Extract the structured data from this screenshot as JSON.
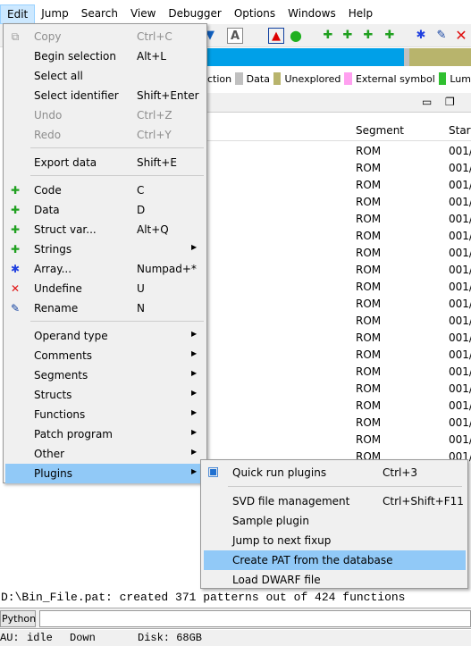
{
  "menubar": [
    "Edit",
    "Jump",
    "Search",
    "View",
    "Debugger",
    "Options",
    "Windows",
    "Help"
  ],
  "legend": [
    {
      "label": "ction",
      "color": ""
    },
    {
      "label": "Data",
      "color": "#c0c0c0"
    },
    {
      "label": "Unexplored",
      "color": "#b8b46c"
    },
    {
      "label": "External symbol",
      "color": "#ffa0f0"
    },
    {
      "label": "Lum",
      "color": "#30c030"
    }
  ],
  "table": {
    "headers": [
      "Segment",
      "Start"
    ],
    "rows": [
      [
        "ROM",
        "001/"
      ],
      [
        "ROM",
        "001/"
      ],
      [
        "ROM",
        "001/"
      ],
      [
        "ROM",
        "001/"
      ],
      [
        "ROM",
        "001/"
      ],
      [
        "ROM",
        "001/"
      ],
      [
        "ROM",
        "001/"
      ],
      [
        "ROM",
        "001/"
      ],
      [
        "ROM",
        "001/"
      ],
      [
        "ROM",
        "001/"
      ],
      [
        "ROM",
        "001/"
      ],
      [
        "ROM",
        "001/"
      ],
      [
        "ROM",
        "001/"
      ],
      [
        "ROM",
        "001/"
      ],
      [
        "ROM",
        "001/"
      ],
      [
        "ROM",
        "001/"
      ],
      [
        "ROM",
        "001/"
      ],
      [
        "ROM",
        "001/"
      ],
      [
        "ROM",
        "001/"
      ]
    ]
  },
  "edit_menu": [
    {
      "label": "Copy",
      "shortcut": "Ctrl+C",
      "icon": "copy-icon",
      "disabled": true
    },
    {
      "label": "Begin selection",
      "shortcut": "Alt+L"
    },
    {
      "label": "Select all",
      "shortcut": ""
    },
    {
      "label": "Select identifier",
      "shortcut": "Shift+Enter"
    },
    {
      "label": "Undo",
      "shortcut": "Ctrl+Z",
      "disabled": true
    },
    {
      "label": "Redo",
      "shortcut": "Ctrl+Y",
      "disabled": true
    },
    {
      "label": "Export data",
      "shortcut": "Shift+E"
    },
    {
      "label": "Code",
      "shortcut": "C",
      "icon": "code-icon"
    },
    {
      "label": "Data",
      "shortcut": "D",
      "icon": "data-icon"
    },
    {
      "label": "Struct var...",
      "shortcut": "Alt+Q",
      "icon": "struct-icon"
    },
    {
      "label": "Strings",
      "shortcut": "",
      "icon": "strings-icon",
      "submenu": true
    },
    {
      "label": "Array...",
      "shortcut": "Numpad+*",
      "icon": "array-icon"
    },
    {
      "label": "Undefine",
      "shortcut": "U",
      "icon": "undefine-icon"
    },
    {
      "label": "Rename",
      "shortcut": "N",
      "icon": "rename-icon"
    },
    {
      "label": "Operand type",
      "submenu": true
    },
    {
      "label": "Comments",
      "submenu": true
    },
    {
      "label": "Segments",
      "submenu": true
    },
    {
      "label": "Structs",
      "submenu": true
    },
    {
      "label": "Functions",
      "submenu": true
    },
    {
      "label": "Patch program",
      "submenu": true
    },
    {
      "label": "Other",
      "submenu": true
    },
    {
      "label": "Plugins",
      "submenu": true,
      "highlighted": true
    }
  ],
  "plugins_menu": [
    {
      "label": "Quick run plugins",
      "shortcut": "Ctrl+3"
    },
    {
      "label": "SVD file management",
      "shortcut": "Ctrl+Shift+F11"
    },
    {
      "label": "Sample plugin",
      "shortcut": ""
    },
    {
      "label": "Jump to next fixup",
      "shortcut": ""
    },
    {
      "label": "Create PAT from the database",
      "shortcut": "",
      "highlighted": true
    },
    {
      "label": "Load DWARF file",
      "shortcut": ""
    }
  ],
  "output_line": "D:\\Bin_File.pat: created 371 patterns out of 424 functions",
  "python_button": "Python",
  "status": {
    "au": "AU:",
    "state": "idle",
    "direction": "Down",
    "disk": "Disk: 68GB"
  }
}
